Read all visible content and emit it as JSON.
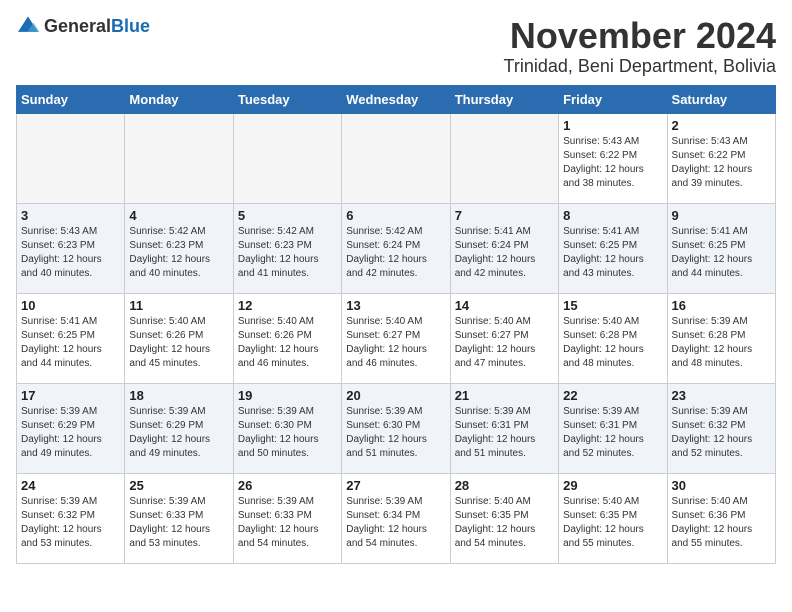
{
  "logo": {
    "general": "General",
    "blue": "Blue"
  },
  "title": "November 2024",
  "location": "Trinidad, Beni Department, Bolivia",
  "days_header": [
    "Sunday",
    "Monday",
    "Tuesday",
    "Wednesday",
    "Thursday",
    "Friday",
    "Saturday"
  ],
  "weeks": [
    [
      {
        "num": "",
        "info": "",
        "empty": true
      },
      {
        "num": "",
        "info": "",
        "empty": true
      },
      {
        "num": "",
        "info": "",
        "empty": true
      },
      {
        "num": "",
        "info": "",
        "empty": true
      },
      {
        "num": "",
        "info": "",
        "empty": true
      },
      {
        "num": "1",
        "info": "Sunrise: 5:43 AM\nSunset: 6:22 PM\nDaylight: 12 hours and 38 minutes."
      },
      {
        "num": "2",
        "info": "Sunrise: 5:43 AM\nSunset: 6:22 PM\nDaylight: 12 hours and 39 minutes."
      }
    ],
    [
      {
        "num": "3",
        "info": "Sunrise: 5:43 AM\nSunset: 6:23 PM\nDaylight: 12 hours and 40 minutes."
      },
      {
        "num": "4",
        "info": "Sunrise: 5:42 AM\nSunset: 6:23 PM\nDaylight: 12 hours and 40 minutes."
      },
      {
        "num": "5",
        "info": "Sunrise: 5:42 AM\nSunset: 6:23 PM\nDaylight: 12 hours and 41 minutes."
      },
      {
        "num": "6",
        "info": "Sunrise: 5:42 AM\nSunset: 6:24 PM\nDaylight: 12 hours and 42 minutes."
      },
      {
        "num": "7",
        "info": "Sunrise: 5:41 AM\nSunset: 6:24 PM\nDaylight: 12 hours and 42 minutes."
      },
      {
        "num": "8",
        "info": "Sunrise: 5:41 AM\nSunset: 6:25 PM\nDaylight: 12 hours and 43 minutes."
      },
      {
        "num": "9",
        "info": "Sunrise: 5:41 AM\nSunset: 6:25 PM\nDaylight: 12 hours and 44 minutes."
      }
    ],
    [
      {
        "num": "10",
        "info": "Sunrise: 5:41 AM\nSunset: 6:25 PM\nDaylight: 12 hours and 44 minutes."
      },
      {
        "num": "11",
        "info": "Sunrise: 5:40 AM\nSunset: 6:26 PM\nDaylight: 12 hours and 45 minutes."
      },
      {
        "num": "12",
        "info": "Sunrise: 5:40 AM\nSunset: 6:26 PM\nDaylight: 12 hours and 46 minutes."
      },
      {
        "num": "13",
        "info": "Sunrise: 5:40 AM\nSunset: 6:27 PM\nDaylight: 12 hours and 46 minutes."
      },
      {
        "num": "14",
        "info": "Sunrise: 5:40 AM\nSunset: 6:27 PM\nDaylight: 12 hours and 47 minutes."
      },
      {
        "num": "15",
        "info": "Sunrise: 5:40 AM\nSunset: 6:28 PM\nDaylight: 12 hours and 48 minutes."
      },
      {
        "num": "16",
        "info": "Sunrise: 5:39 AM\nSunset: 6:28 PM\nDaylight: 12 hours and 48 minutes."
      }
    ],
    [
      {
        "num": "17",
        "info": "Sunrise: 5:39 AM\nSunset: 6:29 PM\nDaylight: 12 hours and 49 minutes."
      },
      {
        "num": "18",
        "info": "Sunrise: 5:39 AM\nSunset: 6:29 PM\nDaylight: 12 hours and 49 minutes."
      },
      {
        "num": "19",
        "info": "Sunrise: 5:39 AM\nSunset: 6:30 PM\nDaylight: 12 hours and 50 minutes."
      },
      {
        "num": "20",
        "info": "Sunrise: 5:39 AM\nSunset: 6:30 PM\nDaylight: 12 hours and 51 minutes."
      },
      {
        "num": "21",
        "info": "Sunrise: 5:39 AM\nSunset: 6:31 PM\nDaylight: 12 hours and 51 minutes."
      },
      {
        "num": "22",
        "info": "Sunrise: 5:39 AM\nSunset: 6:31 PM\nDaylight: 12 hours and 52 minutes."
      },
      {
        "num": "23",
        "info": "Sunrise: 5:39 AM\nSunset: 6:32 PM\nDaylight: 12 hours and 52 minutes."
      }
    ],
    [
      {
        "num": "24",
        "info": "Sunrise: 5:39 AM\nSunset: 6:32 PM\nDaylight: 12 hours and 53 minutes."
      },
      {
        "num": "25",
        "info": "Sunrise: 5:39 AM\nSunset: 6:33 PM\nDaylight: 12 hours and 53 minutes."
      },
      {
        "num": "26",
        "info": "Sunrise: 5:39 AM\nSunset: 6:33 PM\nDaylight: 12 hours and 54 minutes."
      },
      {
        "num": "27",
        "info": "Sunrise: 5:39 AM\nSunset: 6:34 PM\nDaylight: 12 hours and 54 minutes."
      },
      {
        "num": "28",
        "info": "Sunrise: 5:40 AM\nSunset: 6:35 PM\nDaylight: 12 hours and 54 minutes."
      },
      {
        "num": "29",
        "info": "Sunrise: 5:40 AM\nSunset: 6:35 PM\nDaylight: 12 hours and 55 minutes."
      },
      {
        "num": "30",
        "info": "Sunrise: 5:40 AM\nSunset: 6:36 PM\nDaylight: 12 hours and 55 minutes."
      }
    ]
  ]
}
